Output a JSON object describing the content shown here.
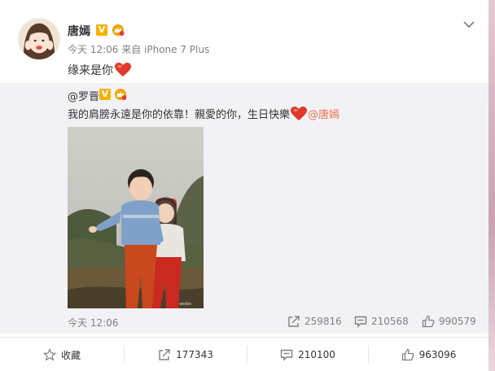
{
  "post": {
    "author": "唐嫣",
    "verified_badge": "V",
    "meta": "今天 12:06 来自 iPhone 7 Plus",
    "text": "缘来是你"
  },
  "repost": {
    "author": "@罗晋",
    "verified_badge": "V",
    "text": "我的肩膀永遠是你的依靠！親愛的你，生日快樂",
    "mention": "@唐嫣",
    "time": "今天 12:06",
    "stats": {
      "repost_count": "259816",
      "comment_count": "210568",
      "like_count": "990579"
    }
  },
  "actions": {
    "favorite_label": "收藏",
    "repost_count": "177343",
    "comment_count": "210100",
    "like_count": "963096"
  },
  "colors": {
    "accent_orange": "#eb7350",
    "verified_gold": "#f7b100",
    "heart_red": "#e0392b",
    "repost_bg": "#f2f2f5"
  },
  "icons": [
    "dropdown-chevron-icon",
    "heart-emoji-icon",
    "crown-icon",
    "repost-icon",
    "comment-icon",
    "like-icon",
    "star-icon"
  ]
}
